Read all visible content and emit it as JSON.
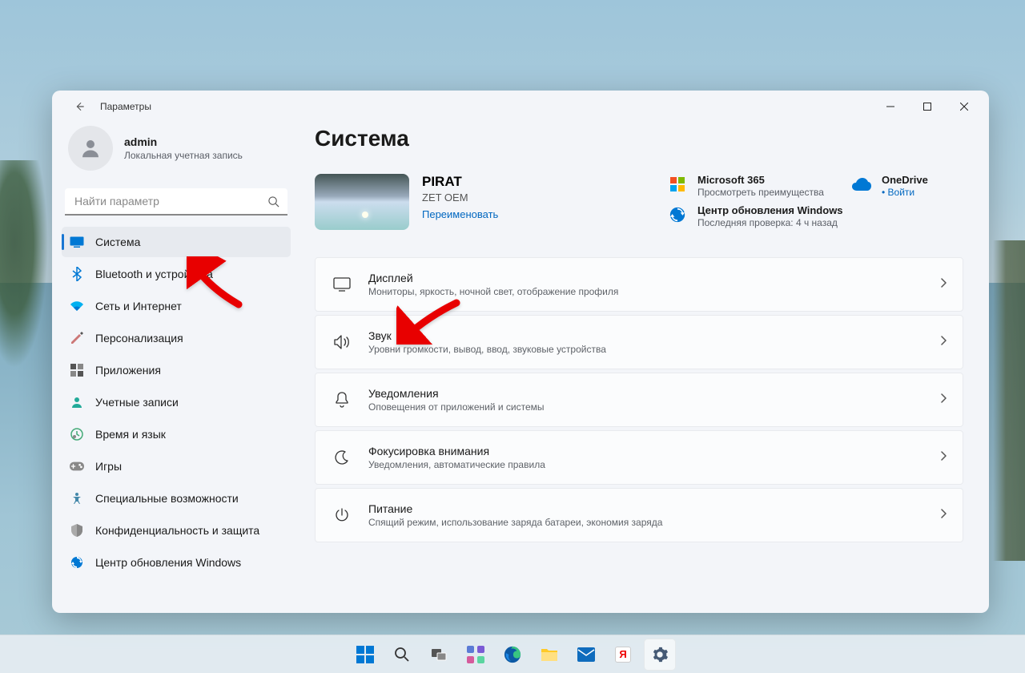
{
  "window": {
    "title": "Параметры"
  },
  "account": {
    "name": "admin",
    "type": "Локальная учетная запись"
  },
  "search": {
    "placeholder": "Найти параметр"
  },
  "nav": [
    {
      "id": "system",
      "label": "Система",
      "active": true
    },
    {
      "id": "bluetooth",
      "label": "Bluetooth и устройства"
    },
    {
      "id": "network",
      "label": "Сеть и Интернет"
    },
    {
      "id": "personalization",
      "label": "Персонализация"
    },
    {
      "id": "apps",
      "label": "Приложения"
    },
    {
      "id": "accounts",
      "label": "Учетные записи"
    },
    {
      "id": "time",
      "label": "Время и язык"
    },
    {
      "id": "gaming",
      "label": "Игры"
    },
    {
      "id": "accessibility",
      "label": "Специальные возможности"
    },
    {
      "id": "privacy",
      "label": "Конфиденциальность и защита"
    },
    {
      "id": "update",
      "label": "Центр обновления Windows"
    }
  ],
  "page": {
    "title": "Система"
  },
  "pc": {
    "name": "PIRAT",
    "model": "ZET OEM",
    "rename": "Переименовать"
  },
  "cards": {
    "ms365": {
      "title": "Microsoft 365",
      "sub": "Просмотреть преимущества"
    },
    "onedrive": {
      "title": "OneDrive",
      "sub": "Войти"
    },
    "update": {
      "title": "Центр обновления Windows",
      "sub": "Последняя проверка: 4 ч назад"
    }
  },
  "settings": [
    {
      "id": "display",
      "title": "Дисплей",
      "sub": "Мониторы, яркость, ночной свет, отображение профиля"
    },
    {
      "id": "sound",
      "title": "Звук",
      "sub": "Уровни громкости, вывод, ввод, звуковые устройства"
    },
    {
      "id": "notifications",
      "title": "Уведомления",
      "sub": "Оповещения от приложений и системы"
    },
    {
      "id": "focus",
      "title": "Фокусировка внимания",
      "sub": "Уведомления, автоматические правила"
    },
    {
      "id": "power",
      "title": "Питание",
      "sub": "Спящий режим, использование заряда батареи, экономия заряда"
    }
  ]
}
